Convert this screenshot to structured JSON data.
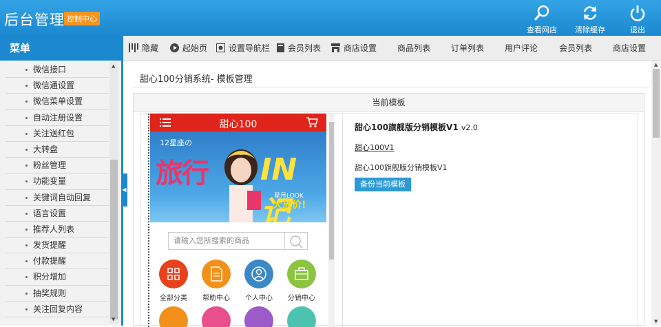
{
  "header": {
    "title": "后台管理",
    "badge": "控制中心",
    "buttons": [
      {
        "label": "查看网店",
        "icon": "search-icon"
      },
      {
        "label": "清除缓存",
        "icon": "refresh-icon"
      },
      {
        "label": "退出",
        "icon": "power-icon"
      }
    ]
  },
  "sidebar": {
    "title": "菜单",
    "items": [
      "微信接口",
      "微信通设置",
      "微信菜单设置",
      "自动注册设置",
      "关注送红包",
      "大转盘",
      "粉丝管理",
      "功能变量",
      "关键词自动回复",
      "语言设置",
      "推荐人列表",
      "发货提醒",
      "付款提醒",
      "积分增加",
      "抽奖规则",
      "关注回复内容"
    ]
  },
  "topnav": {
    "items": [
      {
        "label": "隐藏",
        "icon": "bars-icon"
      },
      {
        "label": "起始页",
        "icon": "play-icon"
      },
      {
        "label": "设置导航栏",
        "icon": "nav-settings-icon"
      },
      {
        "label": "会员列表",
        "icon": "book-icon"
      },
      {
        "label": "商店设置",
        "icon": "shop-icon"
      },
      {
        "label": "商品列表"
      },
      {
        "label": "订单列表"
      },
      {
        "label": "用户评论"
      },
      {
        "label": "会员列表"
      },
      {
        "label": "商店设置"
      }
    ]
  },
  "main": {
    "page_title": "甜心100分销系统- 模板管理",
    "panel_title": "当前模板",
    "template": {
      "name": "甜心100旗舰版分销模板V1",
      "version": "v2.0",
      "code": "甜心100V1",
      "description": "甜心100旗舰版分销模板V1",
      "backup_label": "备份当前模板"
    },
    "preview": {
      "brand": "甜心100",
      "banner_top": "12星座の",
      "banner_main": "旅行",
      "banner_right": "IN记",
      "banner_small": "星月LOOK",
      "banner_sale": "大放价!",
      "search_placeholder": "请输入您所搜索的商品",
      "categories": [
        {
          "label": "全部分类",
          "color": "#e8421d"
        },
        {
          "label": "帮助中心",
          "color": "#f39019"
        },
        {
          "label": "个人中心",
          "color": "#3b88c6"
        },
        {
          "label": "分销中心",
          "color": "#8bc43f"
        }
      ],
      "second_row_colors": [
        "#f39019",
        "#e94f8c",
        "#9b5bc9",
        "#4cc3b0"
      ]
    }
  }
}
